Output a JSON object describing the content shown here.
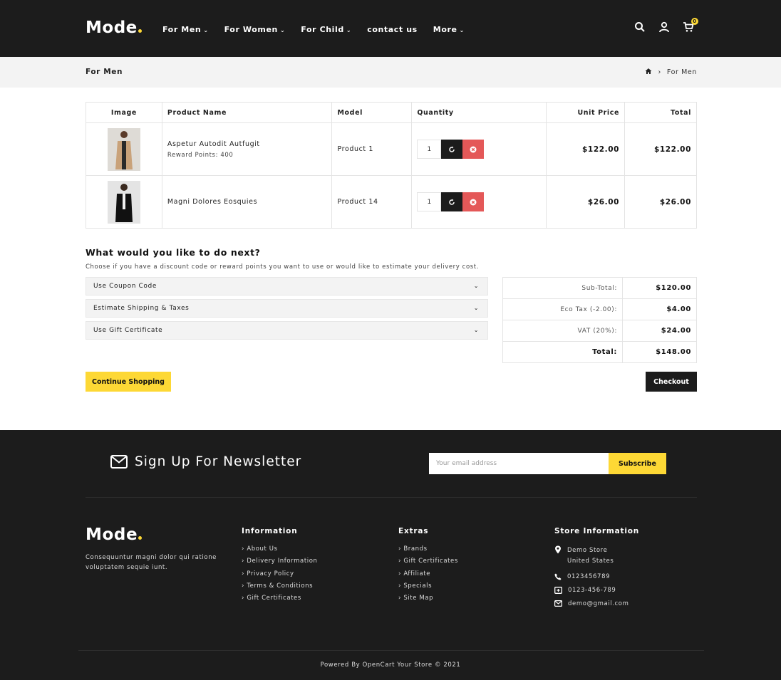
{
  "header": {
    "logo": "Mode",
    "nav": [
      "For Men",
      "For Women",
      "For Child",
      "contact us",
      "More"
    ],
    "cart_count": "0"
  },
  "breadcrumb": {
    "title": "For Men",
    "trail": "For Men"
  },
  "cart": {
    "columns": [
      "Image",
      "Product Name",
      "Model",
      "Quantity",
      "Unit Price",
      "Total"
    ],
    "rows": [
      {
        "name": "Aspetur Autodit Autfugit",
        "reward": "Reward Points: 400",
        "model": "Product 1",
        "qty": "1",
        "unit_price": "$122.00",
        "total": "$122.00"
      },
      {
        "name": "Magni Dolores Eosquies",
        "reward": "",
        "model": "Product 14",
        "qty": "1",
        "unit_price": "$26.00",
        "total": "$26.00"
      }
    ]
  },
  "next": {
    "title": "What would you like to do next?",
    "desc": "Choose if you have a discount code or reward points you want to use or would like to estimate your delivery cost.",
    "panels": [
      "Use Coupon Code",
      "Estimate Shipping & Taxes",
      "Use Gift Certificate"
    ]
  },
  "totals": [
    {
      "label": "Sub-Total:",
      "value": "$120.00"
    },
    {
      "label": "Eco Tax (-2.00):",
      "value": "$4.00"
    },
    {
      "label": "VAT (20%):",
      "value": "$24.00"
    },
    {
      "label": "Total:",
      "value": "$148.00"
    }
  ],
  "buttons": {
    "continue": "Continue Shopping",
    "checkout": "Checkout"
  },
  "footer": {
    "newsletter_title": "Sign Up For Newsletter",
    "email_placeholder": "Your email address",
    "subscribe": "Subscribe",
    "logo": "Mode",
    "about": "Consequuntur magni dolor qui ratione voluptatem sequie iunt.",
    "information": {
      "title": "Information",
      "links": [
        "About Us",
        "Delivery Information",
        "Privacy Policy",
        "Terms & Conditions",
        "Gift Certificates"
      ]
    },
    "extras": {
      "title": "Extras",
      "links": [
        "Brands",
        "Gift Certificates",
        "Affiliate",
        "Specials",
        "Site Map"
      ]
    },
    "store": {
      "title": "Store Information",
      "address_line1": "Demo Store",
      "address_line2": "United States",
      "phone": "0123456789",
      "fax": "0123-456-789",
      "email": "demo@gmail.com"
    },
    "copyright": "Powered By OpenCart Your Store © 2021"
  },
  "colors": {
    "dark": "#1c1c1c",
    "accent": "#fdd835",
    "remove": "#e45858",
    "panel": "#f3f3f3"
  }
}
